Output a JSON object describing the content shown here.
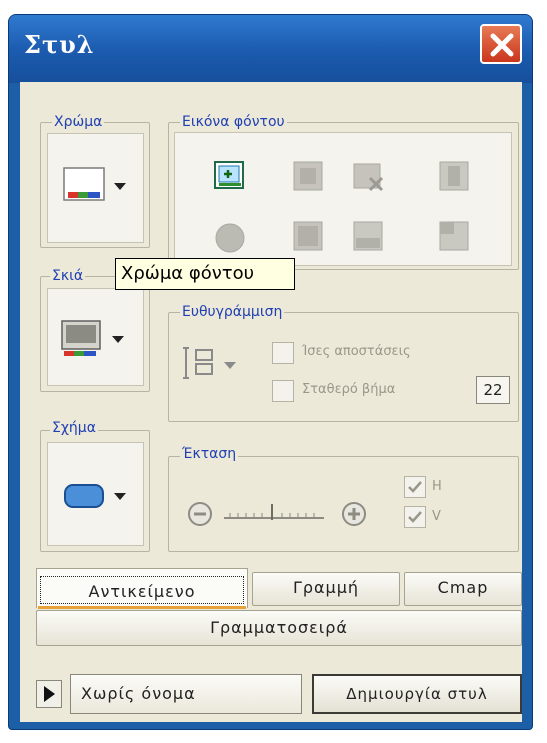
{
  "window": {
    "title": "Στυλ",
    "close_icon": "close-icon"
  },
  "color_group": {
    "label": "Χρώμα"
  },
  "background_image_group": {
    "label": "Εικόνα φόντου"
  },
  "shadow_group": {
    "label": "Σκιά"
  },
  "shape_group": {
    "label": "Σχήμα"
  },
  "tooltip": {
    "text": "Χρώμα φόντου"
  },
  "alignment_group": {
    "label": "Ευθυγράμμιση",
    "equal_spacing": "Ίσες αποστάσεις",
    "fixed_step": "Σταθερό βήμα",
    "step_value": "22"
  },
  "extent_group": {
    "label": "Έκταση",
    "h_label": "H",
    "v_label": "V"
  },
  "tabs": [
    {
      "label": "Αντικείμενο",
      "selected": true
    },
    {
      "label": "Γραμμή",
      "selected": false
    },
    {
      "label": "Cmap",
      "selected": false
    }
  ],
  "font_tab": {
    "label": "Γραμματοσειρά"
  },
  "style_name": {
    "value": "Χωρίς όνομα"
  },
  "create_style_button": {
    "label": "Δημιουργία στυλ"
  },
  "colors": {
    "title_bar": "#1b5aae",
    "dialog_face": "#ece9d8",
    "group_label": "#1f3fb3",
    "tab_underline": "#e8a23a"
  }
}
